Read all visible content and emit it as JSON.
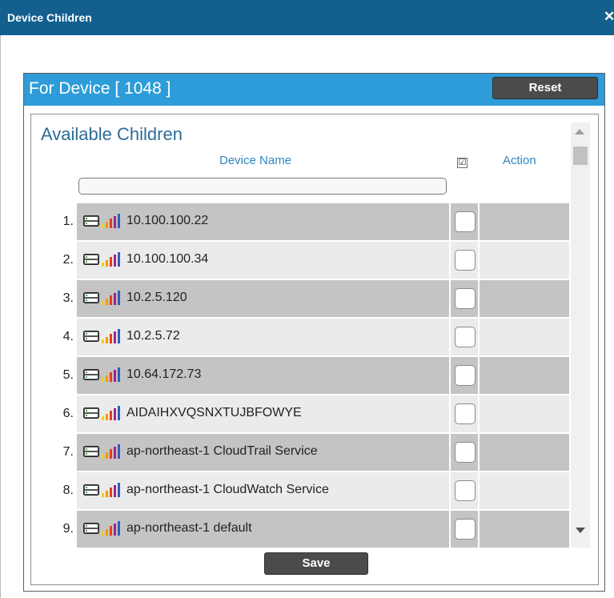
{
  "window": {
    "title": "Device Children",
    "close_glyph": "✕"
  },
  "panel": {
    "title": "For Device [ 1048 ]",
    "reset_label": "Reset"
  },
  "section": {
    "title": "Available Children",
    "columns": {
      "name": "Device Name",
      "action": "Action",
      "select_all_glyph": "☑"
    },
    "filter_value": ""
  },
  "rows": [
    {
      "index": "1.",
      "name": "10.100.100.22",
      "checked": false
    },
    {
      "index": "2.",
      "name": "10.100.100.34",
      "checked": false
    },
    {
      "index": "3.",
      "name": "10.2.5.120",
      "checked": false
    },
    {
      "index": "4.",
      "name": "10.2.5.72",
      "checked": false
    },
    {
      "index": "5.",
      "name": "10.64.172.73",
      "checked": false
    },
    {
      "index": "6.",
      "name": "AIDAIHXVQSNXTUJBFOWYE",
      "checked": false
    },
    {
      "index": "7.",
      "name": "ap-northeast-1 CloudTrail Service",
      "checked": false
    },
    {
      "index": "8.",
      "name": "ap-northeast-1 CloudWatch Service",
      "checked": false
    },
    {
      "index": "9.",
      "name": "ap-northeast-1 default",
      "checked": false
    }
  ],
  "save_label": "Save",
  "icons": {
    "device": "server-device-icon",
    "bars": "signal-bars-icon"
  },
  "colors": {
    "titlebar": "#13608f",
    "panel_header": "#2e9cd9",
    "row_odd": "#c4c4c4",
    "row_even": "#ebebeb",
    "button": "#4b4b4b"
  }
}
